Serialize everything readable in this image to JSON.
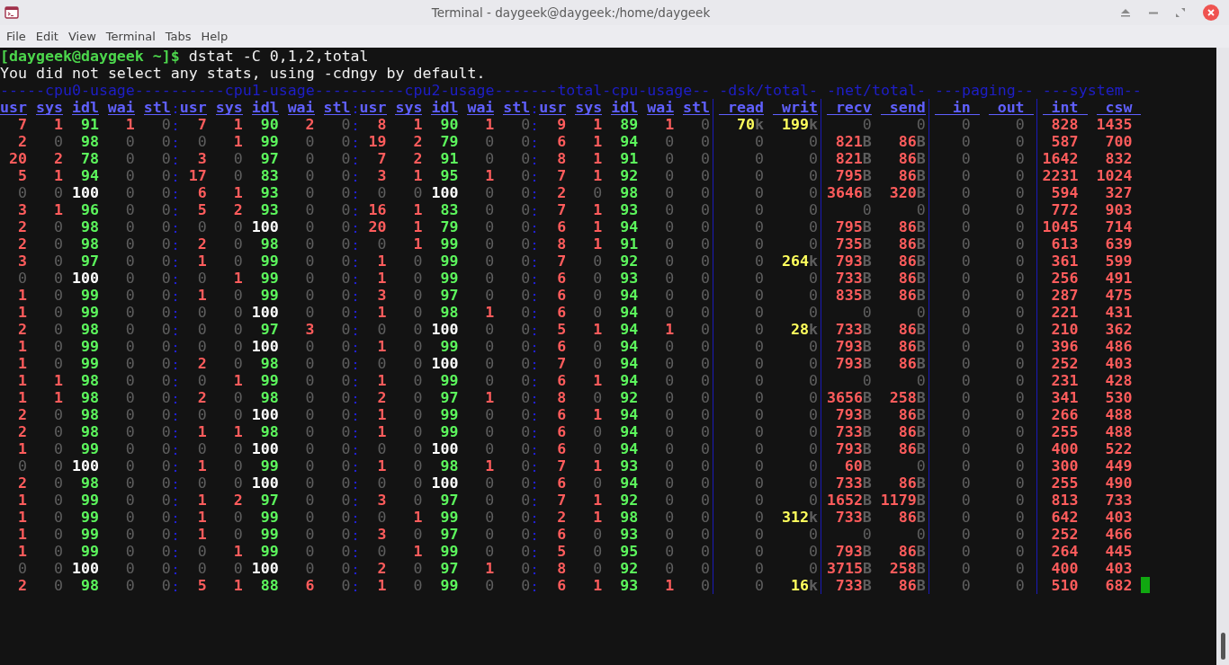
{
  "window": {
    "title": "Terminal - daygeek@daygeek:/home/daygeek"
  },
  "menu": [
    "File",
    "Edit",
    "View",
    "Terminal",
    "Tabs",
    "Help"
  ],
  "terminal": {
    "prompt": "[daygeek@daygeek ~]$",
    "command": "dstat -C 0,1,2,total",
    "output": [
      "You did not select any stats, using -cdngy by default."
    ],
    "groups": [
      {
        "title": "-----cpu0-usage----",
        "kind": "cpu",
        "columns": [
          "usr",
          "sys",
          "idl",
          "wai",
          "stl"
        ]
      },
      {
        "title": "------cpu1-usage----",
        "kind": "cpu",
        "separator_dotted": true,
        "columns": [
          "usr",
          "sys",
          "idl",
          "wai",
          "stl"
        ]
      },
      {
        "title": "------cpu2-usage----",
        "kind": "cpu",
        "separator_dotted": true,
        "columns": [
          "usr",
          "sys",
          "idl",
          "wai",
          "stl"
        ]
      },
      {
        "title": "---total-cpu-usage--",
        "kind": "cpu",
        "separator_dotted": true,
        "columns": [
          "usr",
          "sys",
          "idl",
          "wai",
          "stl"
        ]
      },
      {
        "title": "-dsk/total-",
        "kind": "io",
        "separator_dotted": false,
        "columns": [
          "read",
          "writ"
        ]
      },
      {
        "title": "-net/total-",
        "kind": "io",
        "separator_dotted": false,
        "columns": [
          "recv",
          "send"
        ]
      },
      {
        "title": "---paging--",
        "kind": "count",
        "separator_dotted": false,
        "columns": [
          "in",
          "out"
        ]
      },
      {
        "title": "---system--",
        "kind": "count",
        "separator_dotted": false,
        "columns": [
          "int",
          "csw"
        ]
      }
    ],
    "rows": [
      [
        "7",
        "1",
        "91",
        "1",
        "0",
        "7",
        "1",
        "90",
        "2",
        "0",
        "8",
        "1",
        "90",
        "1",
        "0",
        "9",
        "1",
        "89",
        "1",
        "0",
        "70k",
        "199k",
        "0",
        "0",
        "0",
        "0",
        "828",
        "1435"
      ],
      [
        "2",
        "0",
        "98",
        "0",
        "0",
        "0",
        "1",
        "99",
        "0",
        "0",
        "19",
        "2",
        "79",
        "0",
        "0",
        "6",
        "1",
        "94",
        "0",
        "0",
        "0",
        "0",
        "821B",
        "86B",
        "0",
        "0",
        "587",
        "700"
      ],
      [
        "20",
        "2",
        "78",
        "0",
        "0",
        "3",
        "0",
        "97",
        "0",
        "0",
        "7",
        "2",
        "91",
        "0",
        "0",
        "8",
        "1",
        "91",
        "0",
        "0",
        "0",
        "0",
        "821B",
        "86B",
        "0",
        "0",
        "1642",
        "832"
      ],
      [
        "5",
        "1",
        "94",
        "0",
        "0",
        "17",
        "0",
        "83",
        "0",
        "0",
        "3",
        "1",
        "95",
        "1",
        "0",
        "7",
        "1",
        "92",
        "0",
        "0",
        "0",
        "0",
        "795B",
        "86B",
        "0",
        "0",
        "2231",
        "1024"
      ],
      [
        "0",
        "0",
        "100",
        "0",
        "0",
        "6",
        "1",
        "93",
        "0",
        "0",
        "0",
        "0",
        "100",
        "0",
        "0",
        "2",
        "0",
        "98",
        "0",
        "0",
        "0",
        "0",
        "3646B",
        "320B",
        "0",
        "0",
        "594",
        "327"
      ],
      [
        "3",
        "1",
        "96",
        "0",
        "0",
        "5",
        "2",
        "93",
        "0",
        "0",
        "16",
        "1",
        "83",
        "0",
        "0",
        "7",
        "1",
        "93",
        "0",
        "0",
        "0",
        "0",
        "0",
        "0",
        "0",
        "0",
        "772",
        "903"
      ],
      [
        "2",
        "0",
        "98",
        "0",
        "0",
        "0",
        "0",
        "100",
        "0",
        "0",
        "20",
        "1",
        "79",
        "0",
        "0",
        "6",
        "1",
        "94",
        "0",
        "0",
        "0",
        "0",
        "795B",
        "86B",
        "0",
        "0",
        "1045",
        "714"
      ],
      [
        "2",
        "0",
        "98",
        "0",
        "0",
        "2",
        "0",
        "98",
        "0",
        "0",
        "0",
        "1",
        "99",
        "0",
        "0",
        "8",
        "1",
        "91",
        "0",
        "0",
        "0",
        "0",
        "735B",
        "86B",
        "0",
        "0",
        "613",
        "639"
      ],
      [
        "3",
        "0",
        "97",
        "0",
        "0",
        "1",
        "0",
        "99",
        "0",
        "0",
        "1",
        "0",
        "99",
        "0",
        "0",
        "7",
        "0",
        "92",
        "0",
        "0",
        "0",
        "264k",
        "793B",
        "86B",
        "0",
        "0",
        "361",
        "599"
      ],
      [
        "0",
        "0",
        "100",
        "0",
        "0",
        "0",
        "1",
        "99",
        "0",
        "0",
        "1",
        "0",
        "99",
        "0",
        "0",
        "6",
        "0",
        "93",
        "0",
        "0",
        "0",
        "0",
        "733B",
        "86B",
        "0",
        "0",
        "256",
        "491"
      ],
      [
        "1",
        "0",
        "99",
        "0",
        "0",
        "1",
        "0",
        "99",
        "0",
        "0",
        "3",
        "0",
        "97",
        "0",
        "0",
        "6",
        "0",
        "94",
        "0",
        "0",
        "0",
        "0",
        "835B",
        "86B",
        "0",
        "0",
        "287",
        "475"
      ],
      [
        "1",
        "0",
        "99",
        "0",
        "0",
        "0",
        "0",
        "100",
        "0",
        "0",
        "1",
        "0",
        "98",
        "1",
        "0",
        "6",
        "0",
        "94",
        "0",
        "0",
        "0",
        "0",
        "0",
        "0",
        "0",
        "0",
        "221",
        "431"
      ],
      [
        "2",
        "0",
        "98",
        "0",
        "0",
        "0",
        "0",
        "97",
        "3",
        "0",
        "0",
        "0",
        "100",
        "0",
        "0",
        "5",
        "1",
        "94",
        "1",
        "0",
        "0",
        "28k",
        "733B",
        "86B",
        "0",
        "0",
        "210",
        "362"
      ],
      [
        "1",
        "0",
        "99",
        "0",
        "0",
        "0",
        "0",
        "100",
        "0",
        "0",
        "1",
        "0",
        "99",
        "0",
        "0",
        "6",
        "0",
        "94",
        "0",
        "0",
        "0",
        "0",
        "793B",
        "86B",
        "0",
        "0",
        "396",
        "486"
      ],
      [
        "1",
        "0",
        "99",
        "0",
        "0",
        "2",
        "0",
        "98",
        "0",
        "0",
        "0",
        "0",
        "100",
        "0",
        "0",
        "7",
        "0",
        "94",
        "0",
        "0",
        "0",
        "0",
        "793B",
        "86B",
        "0",
        "0",
        "252",
        "403"
      ],
      [
        "1",
        "1",
        "98",
        "0",
        "0",
        "0",
        "1",
        "99",
        "0",
        "0",
        "1",
        "0",
        "99",
        "0",
        "0",
        "6",
        "1",
        "94",
        "0",
        "0",
        "0",
        "0",
        "0",
        "0",
        "0",
        "0",
        "231",
        "428"
      ],
      [
        "1",
        "1",
        "98",
        "0",
        "0",
        "2",
        "0",
        "98",
        "0",
        "0",
        "2",
        "0",
        "97",
        "1",
        "0",
        "8",
        "0",
        "92",
        "0",
        "0",
        "0",
        "0",
        "3656B",
        "258B",
        "0",
        "0",
        "341",
        "530"
      ],
      [
        "2",
        "0",
        "98",
        "0",
        "0",
        "0",
        "0",
        "100",
        "0",
        "0",
        "1",
        "0",
        "99",
        "0",
        "0",
        "6",
        "1",
        "94",
        "0",
        "0",
        "0",
        "0",
        "793B",
        "86B",
        "0",
        "0",
        "266",
        "488"
      ],
      [
        "2",
        "0",
        "98",
        "0",
        "0",
        "1",
        "1",
        "98",
        "0",
        "0",
        "1",
        "0",
        "99",
        "0",
        "0",
        "6",
        "0",
        "94",
        "0",
        "0",
        "0",
        "0",
        "733B",
        "86B",
        "0",
        "0",
        "255",
        "488"
      ],
      [
        "1",
        "0",
        "99",
        "0",
        "0",
        "0",
        "0",
        "100",
        "0",
        "0",
        "0",
        "0",
        "100",
        "0",
        "0",
        "6",
        "0",
        "94",
        "0",
        "0",
        "0",
        "0",
        "793B",
        "86B",
        "0",
        "0",
        "400",
        "522"
      ],
      [
        "0",
        "0",
        "100",
        "0",
        "0",
        "1",
        "0",
        "99",
        "0",
        "0",
        "1",
        "0",
        "98",
        "1",
        "0",
        "7",
        "1",
        "93",
        "0",
        "0",
        "0",
        "0",
        "60B",
        "0",
        "0",
        "0",
        "300",
        "449"
      ],
      [
        "2",
        "0",
        "98",
        "0",
        "0",
        "0",
        "0",
        "100",
        "0",
        "0",
        "0",
        "0",
        "100",
        "0",
        "0",
        "6",
        "0",
        "94",
        "0",
        "0",
        "0",
        "0",
        "733B",
        "86B",
        "0",
        "0",
        "255",
        "490"
      ],
      [
        "1",
        "0",
        "99",
        "0",
        "0",
        "1",
        "2",
        "97",
        "0",
        "0",
        "3",
        "0",
        "97",
        "0",
        "0",
        "7",
        "1",
        "92",
        "0",
        "0",
        "0",
        "0",
        "1652B",
        "1179B",
        "0",
        "0",
        "813",
        "733"
      ],
      [
        "1",
        "0",
        "99",
        "0",
        "0",
        "1",
        "0",
        "99",
        "0",
        "0",
        "0",
        "1",
        "99",
        "0",
        "0",
        "2",
        "1",
        "98",
        "0",
        "0",
        "0",
        "312k",
        "733B",
        "86B",
        "0",
        "0",
        "642",
        "403"
      ],
      [
        "1",
        "0",
        "99",
        "0",
        "0",
        "1",
        "0",
        "99",
        "0",
        "0",
        "3",
        "0",
        "97",
        "0",
        "0",
        "6",
        "0",
        "93",
        "0",
        "0",
        "0",
        "0",
        "0",
        "0",
        "0",
        "0",
        "252",
        "466"
      ],
      [
        "1",
        "0",
        "99",
        "0",
        "0",
        "0",
        "1",
        "99",
        "0",
        "0",
        "0",
        "1",
        "99",
        "0",
        "0",
        "5",
        "0",
        "95",
        "0",
        "0",
        "0",
        "0",
        "793B",
        "86B",
        "0",
        "0",
        "264",
        "445"
      ],
      [
        "0",
        "0",
        "100",
        "0",
        "0",
        "0",
        "0",
        "100",
        "0",
        "0",
        "2",
        "0",
        "97",
        "1",
        "0",
        "8",
        "0",
        "92",
        "0",
        "0",
        "0",
        "0",
        "3715B",
        "258B",
        "0",
        "0",
        "400",
        "403"
      ],
      [
        "2",
        "0",
        "98",
        "0",
        "0",
        "5",
        "1",
        "88",
        "6",
        "0",
        "1",
        "0",
        "99",
        "0",
        "0",
        "6",
        "1",
        "93",
        "1",
        "0",
        "0",
        "16k",
        "733B",
        "86B",
        "0",
        "0",
        "510",
        "682"
      ]
    ],
    "cursor_visible": true
  }
}
